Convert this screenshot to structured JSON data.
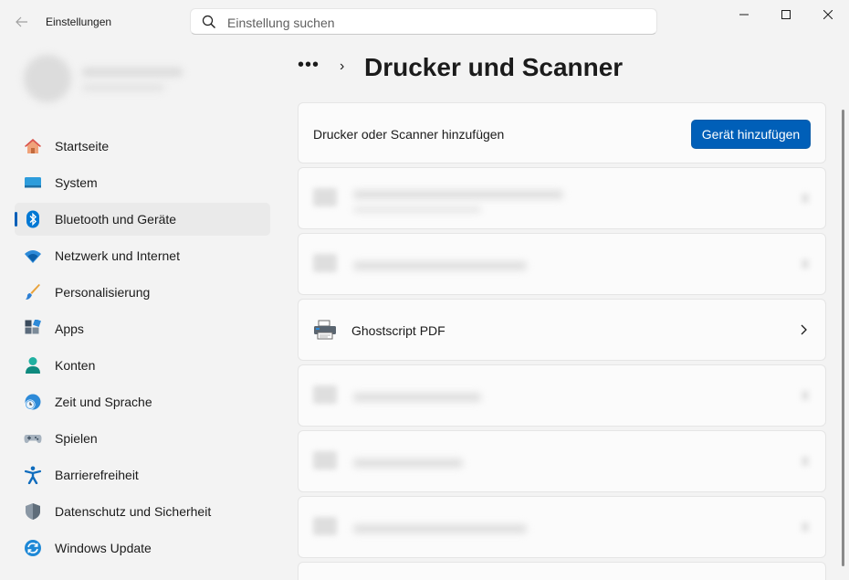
{
  "window": {
    "title": "Einstellungen",
    "back_icon": "arrow-left-icon",
    "controls": [
      "minimize-icon",
      "maximize-icon",
      "close-icon"
    ]
  },
  "search": {
    "placeholder": "Einstellung suchen",
    "value": ""
  },
  "sidebar": {
    "items": [
      {
        "label": "Startseite",
        "icon": "home-icon"
      },
      {
        "label": "System",
        "icon": "monitor-icon"
      },
      {
        "label": "Bluetooth und Geräte",
        "icon": "bluetooth-icon",
        "active": true
      },
      {
        "label": "Netzwerk und Internet",
        "icon": "wifi-icon"
      },
      {
        "label": "Personalisierung",
        "icon": "brush-icon"
      },
      {
        "label": "Apps",
        "icon": "apps-icon"
      },
      {
        "label": "Konten",
        "icon": "person-icon"
      },
      {
        "label": "Zeit und Sprache",
        "icon": "clock-globe-icon"
      },
      {
        "label": "Spielen",
        "icon": "gamepad-icon"
      },
      {
        "label": "Barrierefreiheit",
        "icon": "accessibility-icon"
      },
      {
        "label": "Datenschutz und Sicherheit",
        "icon": "shield-icon"
      },
      {
        "label": "Windows Update",
        "icon": "update-icon"
      }
    ]
  },
  "header": {
    "overflow": "•••",
    "separator": "›",
    "title": "Drucker und Scanner"
  },
  "add_device": {
    "label": "Drucker oder Scanner hinzufügen",
    "button": "Gerät hinzufügen"
  },
  "printer": {
    "name": "Ghostscript PDF",
    "icon": "printer-icon"
  },
  "colors": {
    "accent": "#005fb8",
    "background": "#f3f3f3",
    "card": "#fbfbfb"
  }
}
